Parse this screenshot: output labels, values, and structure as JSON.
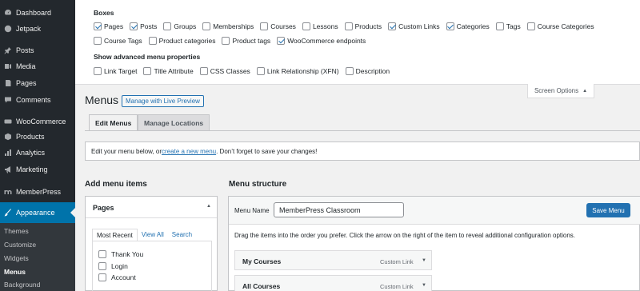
{
  "sidebar": {
    "items": [
      {
        "label": "Dashboard",
        "icon": "dashboard-icon"
      },
      {
        "label": "Jetpack",
        "icon": "jetpack-icon"
      },
      {
        "label": "Posts",
        "icon": "pin-icon"
      },
      {
        "label": "Media",
        "icon": "media-icon"
      },
      {
        "label": "Pages",
        "icon": "page-icon"
      },
      {
        "label": "Comments",
        "icon": "comment-icon"
      },
      {
        "label": "WooCommerce",
        "icon": "woo-icon"
      },
      {
        "label": "Products",
        "icon": "box-icon"
      },
      {
        "label": "Analytics",
        "icon": "bar-chart-icon"
      },
      {
        "label": "Marketing",
        "icon": "megaphone-icon"
      },
      {
        "label": "MemberPress",
        "icon": "memberpress-icon"
      },
      {
        "label": "Appearance",
        "icon": "brush-icon"
      }
    ],
    "submenu": [
      "Themes",
      "Customize",
      "Widgets",
      "Menus",
      "Background"
    ],
    "active_color": "#0073aa"
  },
  "screen_options": {
    "boxes_heading": "Boxes",
    "boxes_row1": [
      {
        "label": "Pages",
        "checked": true
      },
      {
        "label": "Posts",
        "checked": true
      },
      {
        "label": "Groups",
        "checked": false
      },
      {
        "label": "Memberships",
        "checked": false
      },
      {
        "label": "Courses",
        "checked": false
      },
      {
        "label": "Lessons",
        "checked": false
      },
      {
        "label": "Products",
        "checked": false
      },
      {
        "label": "Custom Links",
        "checked": true
      },
      {
        "label": "Categories",
        "checked": true
      },
      {
        "label": "Tags",
        "checked": false
      },
      {
        "label": "Course Categories",
        "checked": false
      }
    ],
    "boxes_row2": [
      {
        "label": "Course Tags",
        "checked": false
      },
      {
        "label": "Product categories",
        "checked": false
      },
      {
        "label": "Product tags",
        "checked": false
      },
      {
        "label": "WooCommerce endpoints",
        "checked": true
      }
    ],
    "advanced_heading": "Show advanced menu properties",
    "advanced": [
      {
        "label": "Link Target",
        "checked": false
      },
      {
        "label": "Title Attribute",
        "checked": false
      },
      {
        "label": "CSS Classes",
        "checked": false
      },
      {
        "label": "Link Relationship (XFN)",
        "checked": false
      },
      {
        "label": "Description",
        "checked": false
      }
    ],
    "tab_label": "Screen Options"
  },
  "main": {
    "title": "Menus",
    "live_preview_label": "Manage with Live Preview",
    "tabs": [
      "Edit Menus",
      "Manage Locations"
    ],
    "notice_before": "Edit your menu below, or ",
    "notice_link": "create a new menu",
    "notice_after": ". Don’t forget to save your changes!",
    "add_items_title": "Add menu items",
    "structure_title": "Menu structure"
  },
  "pages_box": {
    "title": "Pages",
    "tabs": [
      "Most Recent",
      "View All",
      "Search"
    ],
    "items": [
      "Thank You",
      "Login",
      "Account"
    ]
  },
  "menu_structure": {
    "name_label": "Menu Name",
    "name_value": "MemberPress Classroom",
    "save_label": "Save Menu",
    "instructions": "Drag the items into the order you prefer. Click the arrow on the right of the item to reveal additional configuration options.",
    "items": [
      {
        "title": "My Courses",
        "type": "Custom Link"
      },
      {
        "title": "All Courses",
        "type": "Custom Link"
      }
    ]
  }
}
